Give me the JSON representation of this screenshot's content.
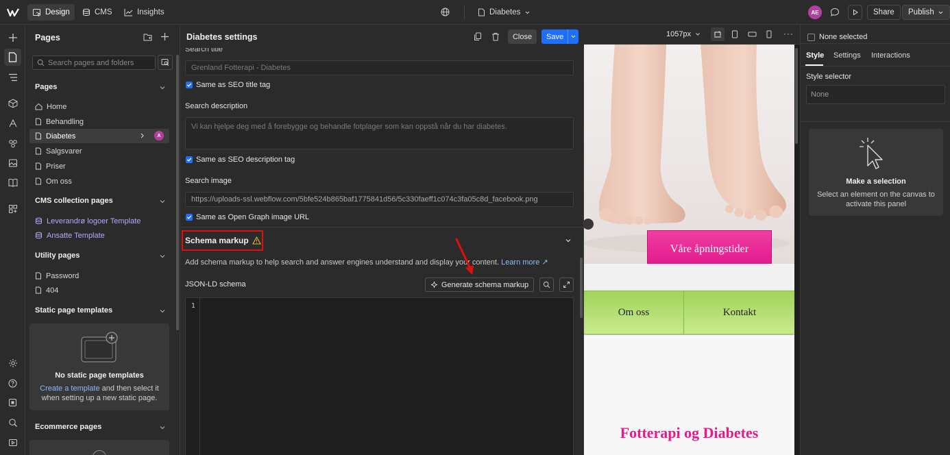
{
  "topbar": {
    "design_label": "Design",
    "cms_label": "CMS",
    "insights_label": "Insights",
    "page_name": "Diabetes",
    "avatar_initials": "AE",
    "share_label": "Share",
    "publish_label": "Publish"
  },
  "pages_panel": {
    "title": "Pages",
    "search_placeholder": "Search pages and folders",
    "sections": {
      "pages": "Pages",
      "cms": "CMS collection pages",
      "utility": "Utility pages",
      "static": "Static page templates",
      "ecommerce": "Ecommerce pages"
    },
    "pages": [
      "Home",
      "Behandling",
      "Diabetes",
      "Salgsvarer",
      "Priser",
      "Om oss"
    ],
    "cms_pages": [
      "Leverandrø logoer Template",
      "Ansatte Template"
    ],
    "utility_pages": [
      "Password",
      "404"
    ],
    "selected_badge": "A",
    "static_empty": {
      "title": "No static page templates",
      "link": "Create a template",
      "text": "and then select it when setting up a new static page."
    }
  },
  "settings": {
    "title": "Diabetes settings",
    "close_label": "Close",
    "save_label": "Save",
    "search_title_label": "Search title",
    "search_title_value": "Grenland Fotterapi - Diabetes",
    "same_seo_title": "Same as SEO title tag",
    "search_description_label": "Search description",
    "search_description_value": "Vi  kan hjelpe deg med å forebygge og behandle fotplager som kan oppstå når du har diabetes.",
    "same_seo_description": "Same as SEO description tag",
    "search_image_label": "Search image",
    "search_image_value": "https://uploads-ssl.webflow.com/5bfe524b865baf1775841d56/5c330faeff1c074c3fa05c8d_facebook.png",
    "same_og_image": "Same as Open Graph image URL",
    "schema_title": "Schema markup",
    "schema_desc": "Add schema markup to help search and answer engines understand and display your content.",
    "learn_more": "Learn more ↗",
    "jsonld_label": "JSON-LD schema",
    "generate_label": "Generate schema markup",
    "line_number": "1"
  },
  "canvas": {
    "width_label": "1057px",
    "hours_button": "Våre åpningstider",
    "nav_items": [
      "Om oss",
      "Kontakt"
    ],
    "heading": "Fotterapi og Diabetes"
  },
  "right_panel": {
    "none_selected": "None selected",
    "tabs": [
      "Style",
      "Settings",
      "Interactions"
    ],
    "style_selector_label": "Style selector",
    "style_selector_value": "None",
    "empty_title": "Make a selection",
    "empty_text": "Select an element on the canvas to activate this panel"
  },
  "colors": {
    "accent_blue": "#1e6fff",
    "highlight_red": "#e01010",
    "site_pink": "#e8198b",
    "site_green": "#b6e07a"
  }
}
